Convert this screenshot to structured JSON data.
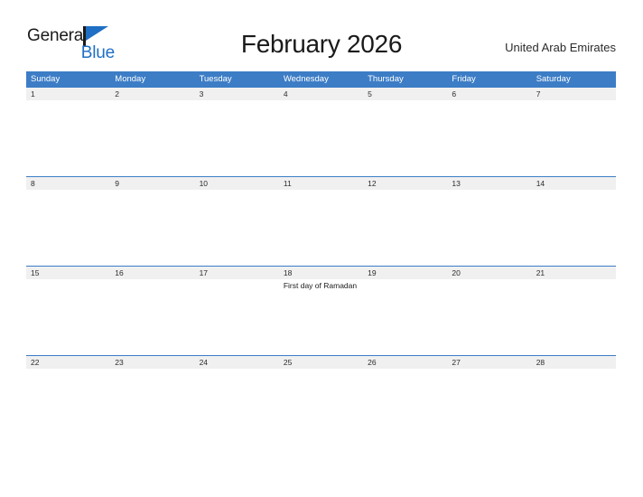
{
  "brand": {
    "name_part1": "General",
    "name_part2": "Blue",
    "flag_icon": "general-blue-flag-icon",
    "color_dark": "#1a1a1a",
    "color_blue": "#1f6fc4"
  },
  "header": {
    "title": "February 2026",
    "region": "United Arab Emirates"
  },
  "calendar": {
    "month": "February",
    "year": "2026",
    "accent_color": "#3c7dc6",
    "day_band_color": "#f0f0f0",
    "weekdays": [
      "Sunday",
      "Monday",
      "Tuesday",
      "Wednesday",
      "Thursday",
      "Friday",
      "Saturday"
    ],
    "weeks": [
      {
        "days": [
          {
            "num": "1",
            "events": []
          },
          {
            "num": "2",
            "events": []
          },
          {
            "num": "3",
            "events": []
          },
          {
            "num": "4",
            "events": []
          },
          {
            "num": "5",
            "events": []
          },
          {
            "num": "6",
            "events": []
          },
          {
            "num": "7",
            "events": []
          }
        ]
      },
      {
        "days": [
          {
            "num": "8",
            "events": []
          },
          {
            "num": "9",
            "events": []
          },
          {
            "num": "10",
            "events": []
          },
          {
            "num": "11",
            "events": []
          },
          {
            "num": "12",
            "events": []
          },
          {
            "num": "13",
            "events": []
          },
          {
            "num": "14",
            "events": []
          }
        ]
      },
      {
        "days": [
          {
            "num": "15",
            "events": []
          },
          {
            "num": "16",
            "events": []
          },
          {
            "num": "17",
            "events": []
          },
          {
            "num": "18",
            "events": [
              "First day of Ramadan"
            ]
          },
          {
            "num": "19",
            "events": []
          },
          {
            "num": "20",
            "events": []
          },
          {
            "num": "21",
            "events": []
          }
        ]
      },
      {
        "days": [
          {
            "num": "22",
            "events": []
          },
          {
            "num": "23",
            "events": []
          },
          {
            "num": "24",
            "events": []
          },
          {
            "num": "25",
            "events": []
          },
          {
            "num": "26",
            "events": []
          },
          {
            "num": "27",
            "events": []
          },
          {
            "num": "28",
            "events": []
          }
        ]
      }
    ]
  }
}
